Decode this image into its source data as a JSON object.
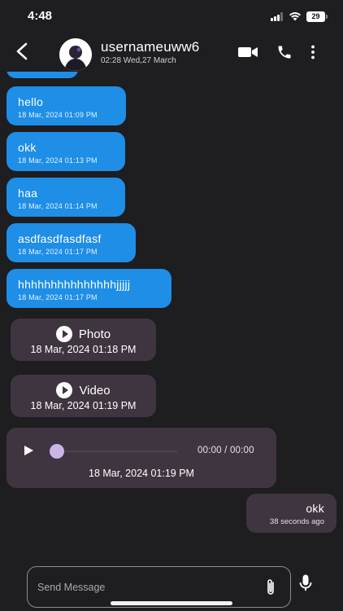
{
  "status_bar": {
    "time": "4:48",
    "battery": "29"
  },
  "header": {
    "username": "usernameuww6",
    "last_seen": "02:28 Wed,27 March",
    "icons": [
      "back-arrow-icon",
      "avatar",
      "video-camera-icon",
      "phone-icon",
      "more-vertical-icon"
    ]
  },
  "messages": [
    {
      "text": "hello",
      "time": "18 Mar, 2024 01:09 PM"
    },
    {
      "text": "okk",
      "time": "18 Mar, 2024 01:13 PM"
    },
    {
      "text": "haa",
      "time": "18 Mar, 2024 01:14 PM"
    },
    {
      "text": "asdfasdfasdfasf",
      "time": "18 Mar, 2024 01:17 PM"
    },
    {
      "text": "hhhhhhhhhhhhhhhjjjjj",
      "time": "18 Mar, 2024 01:17 PM"
    }
  ],
  "media": [
    {
      "label": "Photo",
      "time": "18 Mar, 2024 01:18 PM"
    },
    {
      "label": "Video",
      "time": "18 Mar, 2024 01:19 PM"
    }
  ],
  "audio": {
    "progress": "00:00 / 00:00",
    "time": "18 Mar, 2024 01:19 PM"
  },
  "sent": {
    "text": "okk",
    "time": "38 seconds ago"
  },
  "composer": {
    "placeholder": "Send Message"
  },
  "colors": {
    "background": "#1e1d20",
    "incoming_bubble": "#1e8ee6",
    "media_bubble": "#3f3540",
    "audio_knob": "#c9b5e8"
  }
}
